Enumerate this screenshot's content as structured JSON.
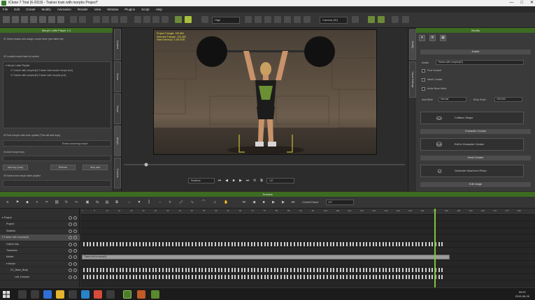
{
  "window": {
    "title": "iClone 7 Trial (6-2019) - Trainer train with morphs Project*",
    "controls": [
      "—",
      "□",
      "✕"
    ]
  },
  "menu": [
    "File",
    "Edit",
    "Create",
    "Modify",
    "Animation",
    "Render",
    "View",
    "Window",
    "Plugins",
    "Script",
    "Help"
  ],
  "toolbar": {
    "quality_select": "High",
    "camera_select": "Camera (ID)"
  },
  "left_panel": {
    "title": "Morph Lottie Player 1.0",
    "step1": "01 Select avatar and assign morph timer (see table list)",
    "step2": "02 Loaded morph tabs for actors",
    "tree_root": "Morph Lottie Playlist",
    "tree_items": [
      "Trainer with morphs(H) Trainer with smoke morph (m4)",
      "Trainer with morphs(H) Trainer with morphs (m4)"
    ],
    "step3": "03 Test morphs with auto update (This will add keys)",
    "set_label": "Erase unrunning morph",
    "step4": "04 Add morph keys",
    "btn_add": "Add key (now)",
    "btn_refresh": "Refresh",
    "btn_stop": "Stop add",
    "step5": "05 Saved and morph table playlist"
  },
  "left_vtabs": [
    "Content",
    "Scene",
    "Visual",
    "Morph",
    "Timeline"
  ],
  "viewport": {
    "info_lines": [
      "Project Triangle: 190,862",
      "Selected Triangle: 126,480",
      "Video Memory: 1.0/6.0GB"
    ]
  },
  "playbar": {
    "mode": "Realtime",
    "frame": "137",
    "icons": [
      "⏮",
      "◀",
      "■",
      "▶",
      "⏭",
      "⟲",
      "⧉"
    ]
  },
  "right_vtabs": [
    "Modify",
    "Visual Settings"
  ],
  "right_panel": {
    "title": "Modify",
    "tabs": [
      "✦",
      "⚙",
      "▦"
    ],
    "section_avatar": "Avatar",
    "avatar_label": "Avatar",
    "avatar_value": "Trainer with morphs(H)",
    "foot_contact": "Foot Contact",
    "hand_contact": "Hand Contact",
    "ankle_bone": "Ankle Bone Mesh",
    "auto_blink_label": "Auto Blink",
    "auto_blink_value": "Normal",
    "body_scale_label": "Body Scale",
    "body_scale_value": "100.000",
    "btn_collision": "Collision Shape",
    "section_creator": "Character Creator",
    "btn_edit_cc": "Edit in Character Creator",
    "section_headshot": "Head Creator",
    "btn_generate_head": "Generate Head from Photo",
    "section_last": "Edit Image"
  },
  "timeline": {
    "title": "Timeline",
    "current_frame_label": "Current Frame",
    "current_frame_value": "137",
    "tracks": [
      {
        "name": "Project",
        "indent": 0,
        "expanded": true
      },
      {
        "name": "Project",
        "indent": 1
      },
      {
        "name": "Switcher",
        "indent": 1
      },
      {
        "name": "Trainer with morphs(H)",
        "indent": 0,
        "expanded": true,
        "selected": true
      },
      {
        "name": "Collect Clip",
        "indent": 1
      },
      {
        "name": "Transform",
        "indent": 1
      },
      {
        "name": "Motion",
        "indent": 1
      },
      {
        "name": "Morph",
        "indent": 1,
        "expanded": true
      },
      {
        "name": "CC_Base_Body",
        "indent": 2
      },
      {
        "name": "Left_Forearm",
        "indent": 3
      }
    ],
    "ruler_marks": [
      "1",
      "5",
      "10",
      "15",
      "20",
      "25",
      "30",
      "35",
      "40",
      "45",
      "50",
      "55",
      "60",
      "65",
      "70",
      "75",
      "80",
      "85",
      "90",
      "95",
      "100",
      "105",
      "110",
      "115",
      "120",
      "125",
      "130",
      "135",
      "140",
      "145",
      "150",
      "155",
      "160",
      "165",
      "170",
      "175",
      "180"
    ],
    "clip_label": "Trainer with morphs(H)"
  },
  "taskbar": {
    "time": "09:02",
    "date": "2019-06-20"
  }
}
